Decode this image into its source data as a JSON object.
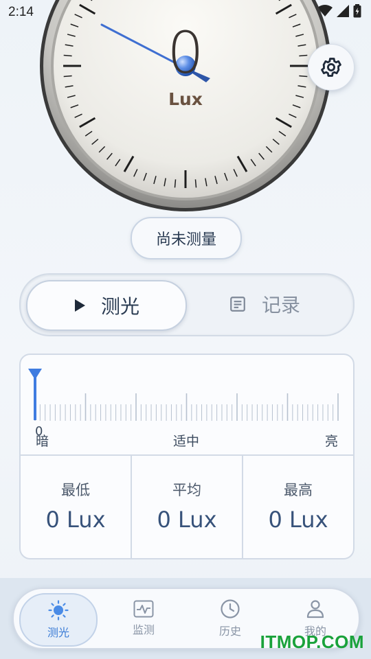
{
  "status_bar": {
    "time": "2:14"
  },
  "gauge": {
    "value": "0",
    "unit": "Lux"
  },
  "measure_status": "尚未测量",
  "mode_toggle": {
    "measure_label": "测光",
    "records_label": "记录"
  },
  "scale": {
    "current": "0",
    "label_dark": "暗",
    "label_mid": "适中",
    "label_bright": "亮"
  },
  "stats": {
    "min": {
      "label": "最低",
      "value": "0 Lux"
    },
    "avg": {
      "label": "平均",
      "value": "0 Lux"
    },
    "max": {
      "label": "最高",
      "value": "0 Lux"
    }
  },
  "bottom_nav": {
    "items": [
      {
        "label": "测光",
        "icon": "sun-icon",
        "active": true
      },
      {
        "label": "监测",
        "icon": "pulse-icon",
        "active": false
      },
      {
        "label": "历史",
        "icon": "clock-icon",
        "active": false
      },
      {
        "label": "我的",
        "icon": "person-icon",
        "active": false
      }
    ]
  },
  "watermark": "ITMOP.COM",
  "colors": {
    "accent": "#3a7bd5",
    "needle": "#3f6fd1",
    "text": "#2a3b52",
    "watermark": "#1aa23b"
  }
}
